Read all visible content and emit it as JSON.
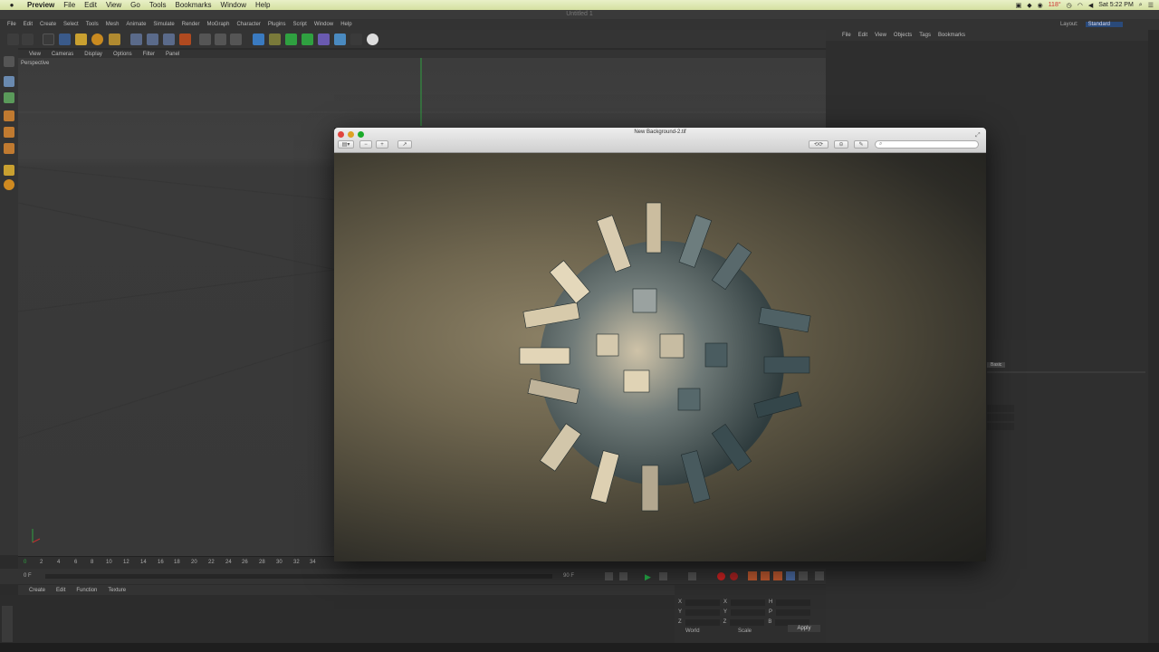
{
  "menubar": {
    "app": "Preview",
    "items": [
      "File",
      "Edit",
      "View",
      "Go",
      "Tools",
      "Bookmarks",
      "Window",
      "Help"
    ],
    "clock": "Sat 5:22 PM",
    "zoom_readout": "118°"
  },
  "c4d": {
    "window_title": "Untitled 1",
    "menu": [
      "File",
      "Edit",
      "Create",
      "Select",
      "Tools",
      "Mesh",
      "Animate",
      "Simulate",
      "Render",
      "MoGraph",
      "Character",
      "Plugins",
      "Script",
      "Window",
      "Help"
    ],
    "layout_label": "Layout:",
    "layout_value": "Standard",
    "viewport_menu": [
      "View",
      "Cameras",
      "Display",
      "Options",
      "Filter",
      "Panel"
    ],
    "viewport_label": "Perspective",
    "object_manager_menu": [
      "File",
      "Edit",
      "View",
      "Objects",
      "Tags",
      "Bookmarks"
    ],
    "material_menu": [
      "Create",
      "Edit",
      "Function",
      "Texture"
    ],
    "timeline_ticks": [
      "0",
      "2",
      "4",
      "6",
      "8",
      "10",
      "12",
      "14",
      "16",
      "18",
      "20",
      "22",
      "24",
      "26",
      "28",
      "30",
      "32",
      "34"
    ],
    "frame_start": "0 F",
    "frame_end": "90 F",
    "coords_labels": [
      "X",
      "Y",
      "Z",
      "X",
      "Y",
      "Z",
      "H",
      "P",
      "B"
    ],
    "coords_mode": "World",
    "coords_scale": "Scale",
    "apply_label": "Apply",
    "attr_tab": "Basic"
  },
  "preview_window": {
    "title": "New Background-2.tif",
    "search_placeholder": ""
  },
  "colors": {
    "menubar_bg": "#dbe6ad",
    "c4d_bg": "#333333",
    "viewport_bg": "#3b3b3b",
    "accent_blue": "#2a4a7a",
    "play_green": "#26b14a",
    "record_red": "#cc2222"
  }
}
